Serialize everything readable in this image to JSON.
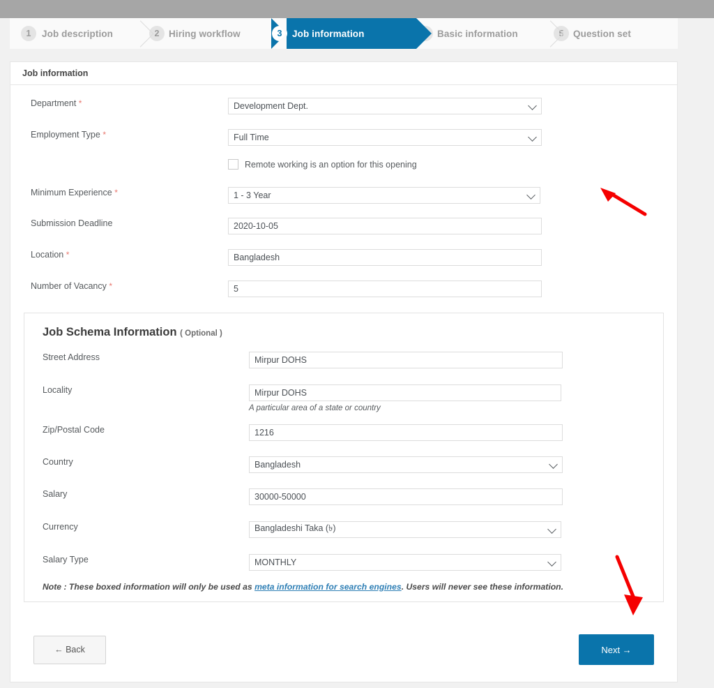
{
  "stepper": {
    "steps": [
      {
        "num": "1",
        "label": "Job description",
        "active": false
      },
      {
        "num": "2",
        "label": "Hiring workflow",
        "active": false
      },
      {
        "num": "3",
        "label": "Job information",
        "active": true
      },
      {
        "num": "4",
        "label": "Basic information",
        "active": false
      },
      {
        "num": "5",
        "label": "Question set",
        "active": false
      }
    ]
  },
  "card": {
    "title": "Job information"
  },
  "job_information": {
    "department": {
      "label": "Department",
      "required": "*",
      "value": "Development Dept."
    },
    "employment_type": {
      "label": "Employment Type",
      "required": "*",
      "value": "Full Time"
    },
    "remote": {
      "checkbox_label": "Remote working is an option for this opening",
      "checked": false
    },
    "minimum_experience": {
      "label": "Minimum Experience",
      "required": "*",
      "value": "1 - 3 Year"
    },
    "submission_deadline": {
      "label": "Submission Deadline",
      "value": "2020-10-05"
    },
    "location": {
      "label": "Location",
      "required": "*",
      "value": "Bangladesh"
    },
    "number_of_vacancy": {
      "label": "Number of Vacancy",
      "required": "*",
      "value": "5"
    }
  },
  "schema": {
    "title": "Job Schema Information",
    "optional": "( Optional )",
    "street_address": {
      "label": "Street Address",
      "value": "Mirpur DOHS"
    },
    "locality": {
      "label": "Locality",
      "value": "Mirpur DOHS",
      "help": "A particular area of a state or country"
    },
    "zip": {
      "label": "Zip/Postal Code",
      "value": "1216"
    },
    "country": {
      "label": "Country",
      "value": "Bangladesh"
    },
    "salary": {
      "label": "Salary",
      "value": "30000-50000"
    },
    "currency": {
      "label": "Currency",
      "value": "Bangladeshi Taka (৳)"
    },
    "salary_type": {
      "label": "Salary Type",
      "value": "MONTHLY"
    },
    "note_prefix": "Note : These boxed information will only be used as ",
    "note_link": "meta information for search engines",
    "note_suffix": ". Users will never see these information."
  },
  "footer": {
    "back_label": "← Back",
    "next_label": "Next →"
  },
  "annotations": {
    "arrow_color": "#f50000",
    "arrow_1": "arrow-pointing-up-left-at-minimum-experience",
    "arrow_2": "arrow-pointing-down-at-salary-type"
  },
  "colors": {
    "accent": "#0a74ab",
    "page_bg": "#f1f1f1",
    "top_bar": "#a6a6a6",
    "required_star": "#e8776e"
  }
}
